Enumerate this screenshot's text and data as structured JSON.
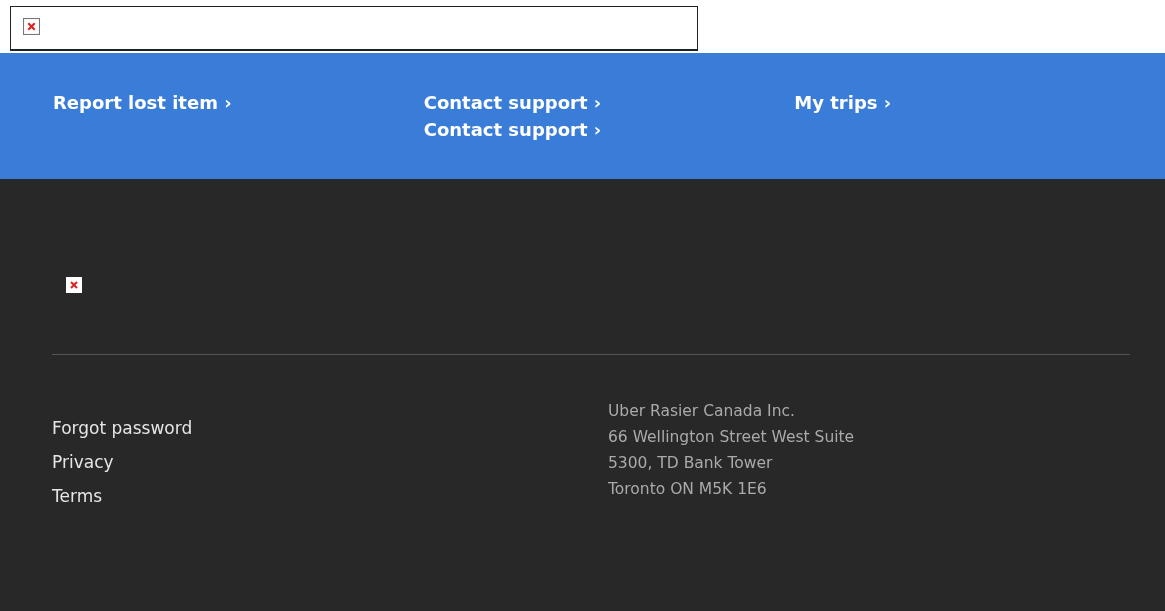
{
  "nav_links": [
    {
      "labels": [
        "Report lost item ›"
      ]
    },
    {
      "labels": [
        "Contact support ›",
        "Contact support ›"
      ]
    },
    {
      "labels": [
        "My trips ›"
      ]
    }
  ],
  "footer_links": [
    "Forgot password",
    "Privacy",
    "Terms"
  ],
  "address": [
    "Uber Rasier Canada Inc.",
    "66 Wellington Street West Suite",
    "5300, TD Bank Tower",
    "Toronto ON M5K 1E6"
  ]
}
